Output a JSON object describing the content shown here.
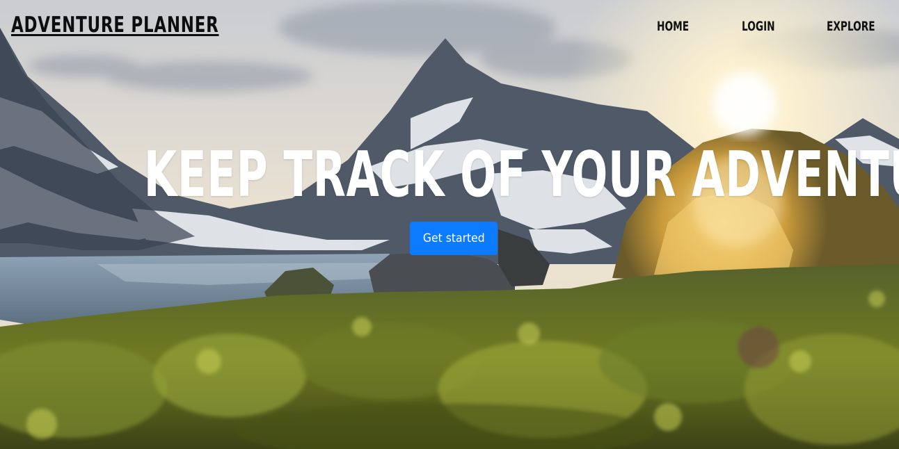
{
  "header": {
    "brand": "ADVENTURE PLANNER",
    "nav": [
      {
        "label": "HOME"
      },
      {
        "label": "LOGIN"
      },
      {
        "label": "EXPLORE"
      }
    ]
  },
  "hero": {
    "headline": "KEEP TRACK OF YOUR ADVENTURES",
    "cta_label": "Get started",
    "background": "mountain-lake-camping-tent-photo"
  },
  "colors": {
    "cta": "#0d7bff",
    "nav_text": "#111111",
    "headline": "#ffffff"
  }
}
